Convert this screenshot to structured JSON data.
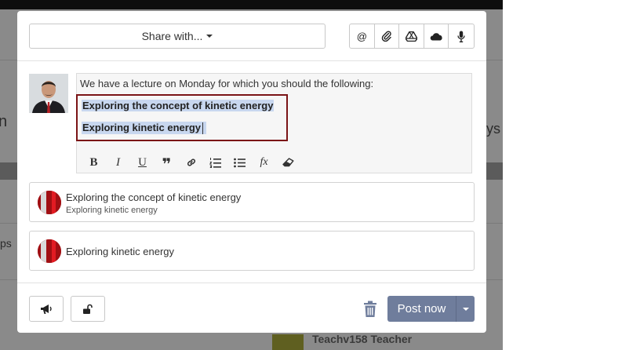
{
  "background": {
    "left_text": "n",
    "right_text": "ys",
    "ps_text": "ps",
    "teacher_name": "Teachv158 Teacher"
  },
  "composer": {
    "share_label": "Share with...",
    "toolbar_icons": [
      "at-icon",
      "paperclip-icon",
      "google-drive-icon",
      "onedrive-icon",
      "microphone-icon"
    ],
    "at_symbol": "@",
    "editor_text": "We have a lecture on Monday for which you should the following:",
    "selected_lines": [
      "Exploring the concept of kinetic energy",
      "Exploring kinetic energy"
    ],
    "format": {
      "bold": "B",
      "italic": "I",
      "underline": "U",
      "quote": "❞",
      "formula": "fx"
    }
  },
  "suggestions": [
    {
      "title": "Exploring the concept of kinetic energy",
      "subtitle": "Exploring kinetic energy"
    },
    {
      "title": "Exploring kinetic energy",
      "subtitle": ""
    }
  ],
  "footer": {
    "post_label": "Post now"
  },
  "colors": {
    "highlight_border": "#7b1416",
    "selection": "#c8d7ef",
    "post_button": "#6f7d9c",
    "trash": "#6f7d9c"
  }
}
